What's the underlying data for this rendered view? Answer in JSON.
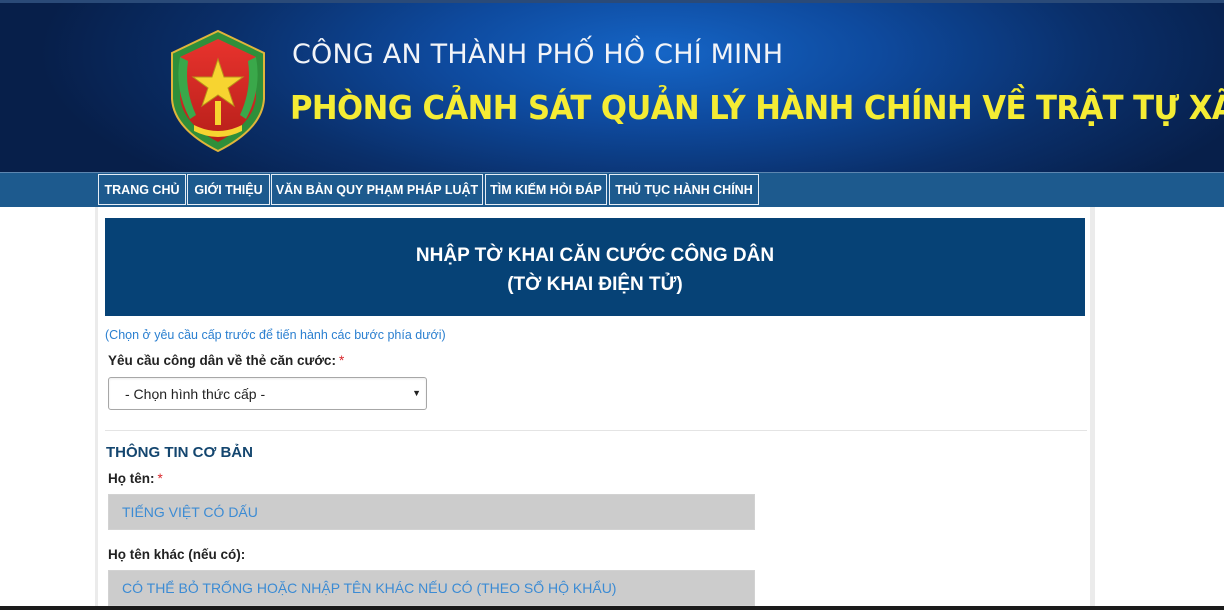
{
  "header": {
    "title_line1": "CÔNG AN THÀNH PHỐ HỒ CHÍ MINH",
    "title_line2": "PHÒNG CẢNH SÁT QUẢN LÝ HÀNH CHÍNH VỀ TRẬT TỰ XÃ HỘI",
    "logo_icon": "police-emblem-icon"
  },
  "nav": {
    "items": [
      {
        "label": "TRANG CHỦ"
      },
      {
        "label": "GIỚI THIỆU"
      },
      {
        "label": "VĂN BẢN QUY PHẠM PHÁP LUẬT"
      },
      {
        "label": "TÌM KIẾM HỎI ĐÁP"
      },
      {
        "label": "THỦ TỤC HÀNH CHÍNH"
      }
    ]
  },
  "form": {
    "title_line1": "NHẬP TỜ KHAI CĂN CƯỚC CÔNG DÂN",
    "title_line2": "(TỜ KHAI ĐIỆN TỬ)",
    "hint": "(Chọn ở yêu cầu cấp trước để tiến hành các bước phía dưới)",
    "request_label": "Yêu cầu công dân về thẻ căn cước:",
    "required_mark": "*",
    "request_select_value": "- Chọn hình thức cấp -",
    "section_basic": "THÔNG TIN CƠ BẢN",
    "name_label": "Họ tên:",
    "name_placeholder": "TIẾNG VIỆT CÓ DẤU",
    "other_name_label": "Họ tên khác (nếu có):",
    "other_name_placeholder": "CÓ THỂ BỎ TRỐNG HOẶC NHẬP TÊN KHÁC NẾU CÓ (THEO SỔ HỘ KHẨU)"
  },
  "colors": {
    "header_bg": "#0a2f6a",
    "title_yellow": "#f5ec34",
    "nav_bg": "#1d5a8e",
    "form_header_bg": "#064276",
    "hint_blue": "#2a7fd0",
    "required_red": "#d8262b"
  }
}
